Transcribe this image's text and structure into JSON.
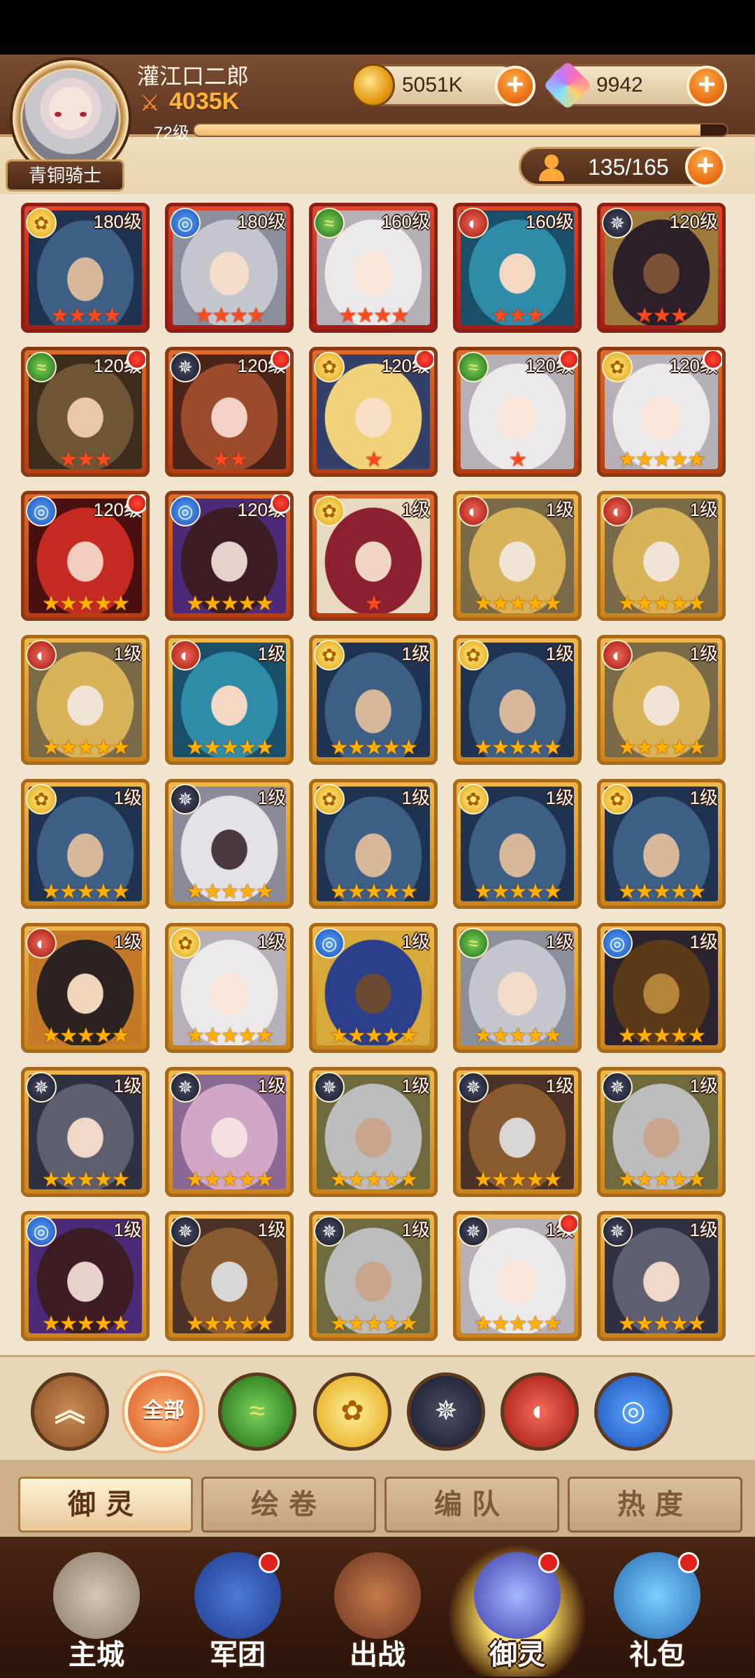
{
  "player": {
    "name": "灌江口二郎",
    "power": "4035K",
    "level_label": "72级",
    "level_progress": 0.95,
    "rank": "青铜骑士"
  },
  "resources": {
    "gold": "5051K",
    "gems": "9942",
    "heroes_count": "135/165"
  },
  "plus_symbol": "+",
  "heroes": [
    {
      "level": "180级",
      "element": "gold",
      "stars": 4,
      "star_color": "red",
      "portrait": "p-blue",
      "dot": false,
      "frame": "red"
    },
    {
      "level": "180级",
      "element": "blue",
      "stars": 4,
      "star_color": "red",
      "portrait": "p-silver",
      "dot": false,
      "frame": "red"
    },
    {
      "level": "160级",
      "element": "green",
      "stars": 4,
      "star_color": "red",
      "portrait": "p-white",
      "dot": false,
      "frame": "red"
    },
    {
      "level": "160级",
      "element": "red",
      "stars": 3,
      "star_color": "red",
      "portrait": "p-teal",
      "dot": false,
      "frame": "red"
    },
    {
      "level": "120级",
      "element": "dark",
      "stars": 3,
      "star_color": "red",
      "portrait": "p-dark",
      "dot": false,
      "frame": "red"
    },
    {
      "level": "120级",
      "element": "green",
      "stars": 3,
      "star_color": "red",
      "portrait": "p-brown",
      "dot": true,
      "frame": "orange"
    },
    {
      "level": "120级",
      "element": "dark",
      "stars": 2,
      "star_color": "red",
      "portrait": "p-auburn",
      "dot": true,
      "frame": "orange"
    },
    {
      "level": "120级",
      "element": "gold",
      "stars": 1,
      "star_color": "red",
      "portrait": "p-blond",
      "dot": true,
      "frame": "orange"
    },
    {
      "level": "120级",
      "element": "green",
      "stars": 1,
      "star_color": "red",
      "portrait": "p-white",
      "dot": true,
      "frame": "orange"
    },
    {
      "level": "120级",
      "element": "gold",
      "stars": 5,
      "star_color": "gold",
      "portrait": "p-white",
      "dot": true,
      "frame": "orange"
    },
    {
      "level": "120级",
      "element": "blue",
      "stars": 5,
      "star_color": "gold",
      "portrait": "p-red",
      "dot": true,
      "frame": "orange"
    },
    {
      "level": "120级",
      "element": "blue",
      "stars": 5,
      "star_color": "gold",
      "portrait": "p-vampire",
      "dot": true,
      "frame": "orange"
    },
    {
      "level": "1级",
      "element": "gold",
      "stars": 1,
      "star_color": "red",
      "portrait": "p-crimson",
      "dot": false,
      "frame": "orange"
    },
    {
      "level": "1级",
      "element": "red",
      "stars": 5,
      "star_color": "gold",
      "portrait": "p-gold",
      "dot": false,
      "frame": "gold"
    },
    {
      "level": "1级",
      "element": "red",
      "stars": 5,
      "star_color": "gold",
      "portrait": "p-gold",
      "dot": false,
      "frame": "gold"
    },
    {
      "level": "1级",
      "element": "red",
      "stars": 5,
      "star_color": "gold",
      "portrait": "p-gold",
      "dot": false,
      "frame": "gold"
    },
    {
      "level": "1级",
      "element": "red",
      "stars": 5,
      "star_color": "gold",
      "portrait": "p-teal",
      "dot": false,
      "frame": "gold"
    },
    {
      "level": "1级",
      "element": "gold",
      "stars": 5,
      "star_color": "gold",
      "portrait": "p-blue",
      "dot": false,
      "frame": "gold"
    },
    {
      "level": "1级",
      "element": "gold",
      "stars": 5,
      "star_color": "gold",
      "portrait": "p-blue",
      "dot": false,
      "frame": "gold"
    },
    {
      "level": "1级",
      "element": "red",
      "stars": 5,
      "star_color": "gold",
      "portrait": "p-gold",
      "dot": false,
      "frame": "gold"
    },
    {
      "level": "1级",
      "element": "gold",
      "stars": 5,
      "star_color": "gold",
      "portrait": "p-blue",
      "dot": false,
      "frame": "gold"
    },
    {
      "level": "1级",
      "element": "dark",
      "stars": 5,
      "star_color": "gold",
      "portrait": "p-ebony",
      "dot": false,
      "frame": "gold"
    },
    {
      "level": "1级",
      "element": "gold",
      "stars": 5,
      "star_color": "gold",
      "portrait": "p-blue",
      "dot": false,
      "frame": "gold"
    },
    {
      "level": "1级",
      "element": "gold",
      "stars": 5,
      "star_color": "gold",
      "portrait": "p-blue",
      "dot": false,
      "frame": "gold"
    },
    {
      "level": "1级",
      "element": "gold",
      "stars": 5,
      "star_color": "gold",
      "portrait": "p-blue",
      "dot": false,
      "frame": "gold"
    },
    {
      "level": "1级",
      "element": "red",
      "stars": 5,
      "star_color": "gold",
      "portrait": "p-samurai",
      "dot": false,
      "frame": "gold"
    },
    {
      "level": "1级",
      "element": "gold",
      "stars": 5,
      "star_color": "gold",
      "portrait": "p-white",
      "dot": false,
      "frame": "gold"
    },
    {
      "level": "1级",
      "element": "blue",
      "stars": 5,
      "star_color": "gold",
      "portrait": "p-pharaoh",
      "dot": false,
      "frame": "gold"
    },
    {
      "level": "1级",
      "element": "green",
      "stars": 5,
      "star_color": "gold",
      "portrait": "p-silver",
      "dot": false,
      "frame": "gold"
    },
    {
      "level": "1级",
      "element": "blue",
      "stars": 5,
      "star_color": "gold",
      "portrait": "p-sphinx",
      "dot": false,
      "frame": "gold"
    },
    {
      "level": "1级",
      "element": "dark",
      "stars": 5,
      "star_color": "gold",
      "portrait": "p-grey",
      "dot": false,
      "frame": "gold"
    },
    {
      "level": "1级",
      "element": "dark",
      "stars": 5,
      "star_color": "gold",
      "portrait": "p-pink",
      "dot": false,
      "frame": "gold"
    },
    {
      "level": "1级",
      "element": "dark",
      "stars": 5,
      "star_color": "gold",
      "portrait": "p-elder",
      "dot": false,
      "frame": "gold"
    },
    {
      "level": "1级",
      "element": "dark",
      "stars": 5,
      "star_color": "gold",
      "portrait": "p-mask",
      "dot": false,
      "frame": "gold"
    },
    {
      "level": "1级",
      "element": "dark",
      "stars": 5,
      "star_color": "gold",
      "portrait": "p-elder",
      "dot": false,
      "frame": "gold"
    },
    {
      "level": "1级",
      "element": "blue",
      "stars": 5,
      "star_color": "gold",
      "portrait": "p-vampire",
      "dot": false,
      "frame": "gold"
    },
    {
      "level": "1级",
      "element": "dark",
      "stars": 5,
      "star_color": "gold",
      "portrait": "p-mask",
      "dot": false,
      "frame": "gold"
    },
    {
      "level": "1级",
      "element": "dark",
      "stars": 5,
      "star_color": "gold",
      "portrait": "p-elder",
      "dot": false,
      "frame": "gold"
    },
    {
      "level": "1级",
      "element": "dark",
      "stars": 5,
      "star_color": "gold",
      "portrait": "p-white",
      "dot": true,
      "frame": "gold"
    },
    {
      "level": "1级",
      "element": "dark",
      "stars": 5,
      "star_color": "gold",
      "portrait": "p-grey",
      "dot": false,
      "frame": "gold"
    }
  ],
  "filters": {
    "all_label": "全部"
  },
  "subtabs": [
    "御灵",
    "绘卷",
    "编队",
    "热度"
  ],
  "nav": [
    "主城",
    "军团",
    "出战",
    "御灵",
    "礼包"
  ]
}
